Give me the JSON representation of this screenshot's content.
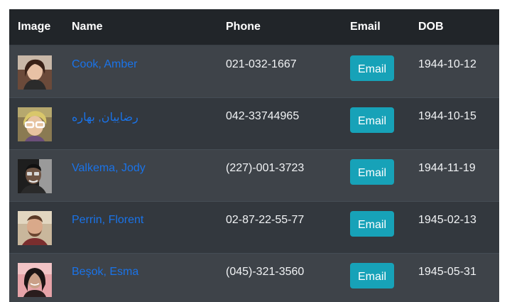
{
  "table": {
    "headers": {
      "image": "Image",
      "name": "Name",
      "phone": "Phone",
      "email": "Email",
      "dob": "DOB"
    },
    "rows": [
      {
        "name": "Cook, Amber",
        "phone": "021-032-1667",
        "email_button": "Email",
        "dob": "1944-10-12",
        "avatar_icon": "person-photo-icon"
      },
      {
        "name": "رضاییان, بهاره",
        "phone": "042-33744965",
        "email_button": "Email",
        "dob": "1944-10-15",
        "avatar_icon": "person-photo-icon"
      },
      {
        "name": "Valkema, Jody",
        "phone": "(227)-001-3723",
        "email_button": "Email",
        "dob": "1944-11-19",
        "avatar_icon": "person-photo-icon"
      },
      {
        "name": "Perrin, Florent",
        "phone": "02-87-22-55-77",
        "email_button": "Email",
        "dob": "1945-02-13",
        "avatar_icon": "person-photo-icon"
      },
      {
        "name": "Beşok, Esma",
        "phone": "(045)-321-3560",
        "email_button": "Email",
        "dob": "1945-05-31",
        "avatar_icon": "person-photo-icon"
      }
    ]
  },
  "colors": {
    "table_bg": "#343a40",
    "header_bg": "#212529",
    "link": "#1a73e8",
    "button": "#17a2b8"
  }
}
